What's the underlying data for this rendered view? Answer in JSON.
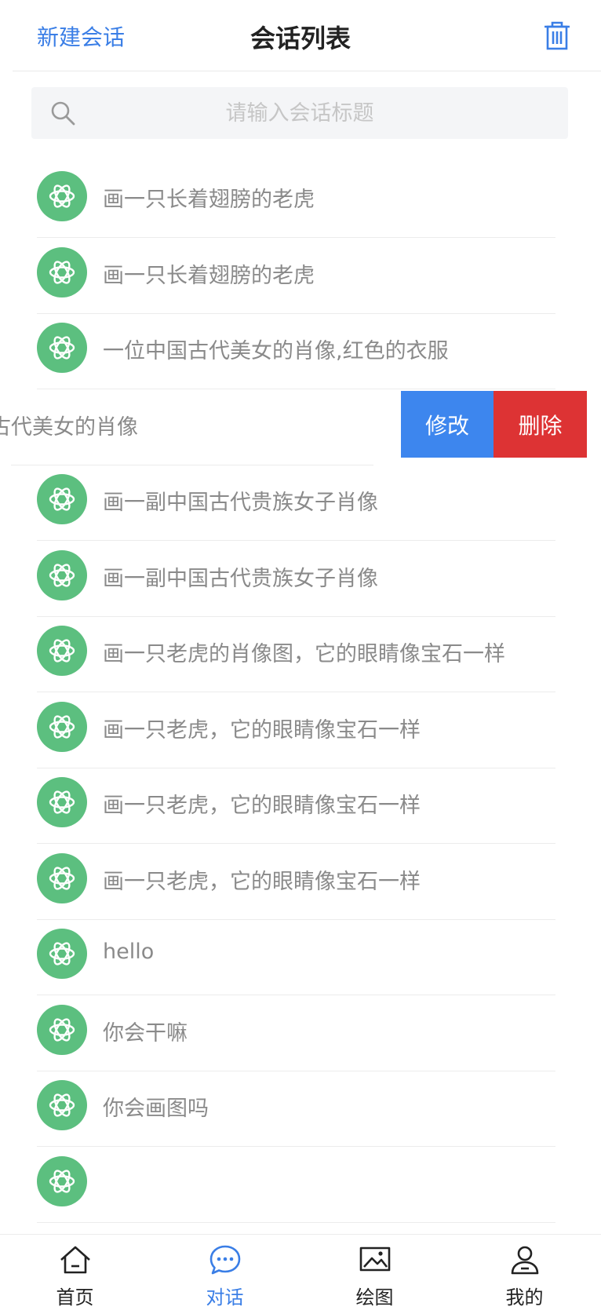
{
  "header": {
    "new_chat_label": "新建会话",
    "title": "会话列表",
    "trash_icon": "trash-icon"
  },
  "search": {
    "placeholder": "请输入会话标题",
    "icon": "search-icon"
  },
  "conversations": [
    {
      "title": "画一只长着翅膀的老虎",
      "icon": "openai-logo-icon"
    },
    {
      "title": "画一只长着翅膀的老虎",
      "icon": "openai-logo-icon"
    },
    {
      "title": "一位中国古代美女的肖像,红色的衣服",
      "icon": "openai-logo-icon"
    },
    {
      "title": "古代美女的肖像",
      "icon": "openai-logo-icon",
      "swiped": true
    },
    {
      "title": "画一副中国古代贵族女子肖像",
      "icon": "openai-logo-icon"
    },
    {
      "title": "画一副中国古代贵族女子肖像",
      "icon": "openai-logo-icon"
    },
    {
      "title": "画一只老虎的肖像图，它的眼睛像宝石一样",
      "icon": "openai-logo-icon"
    },
    {
      "title": "画一只老虎，它的眼睛像宝石一样",
      "icon": "openai-logo-icon"
    },
    {
      "title": "画一只老虎，它的眼睛像宝石一样",
      "icon": "openai-logo-icon"
    },
    {
      "title": "画一只老虎，它的眼睛像宝石一样",
      "icon": "openai-logo-icon"
    },
    {
      "title": "hello",
      "icon": "openai-logo-icon"
    },
    {
      "title": "你会干嘛",
      "icon": "openai-logo-icon"
    },
    {
      "title": "你会画图吗",
      "icon": "openai-logo-icon"
    },
    {
      "title": "",
      "icon": "openai-logo-icon"
    }
  ],
  "swipe_actions": {
    "edit_label": "修改",
    "delete_label": "删除"
  },
  "tabbar": {
    "items": [
      {
        "label": "首页",
        "icon": "home-icon",
        "active": false
      },
      {
        "label": "对话",
        "icon": "chat-bubble-icon",
        "active": true
      },
      {
        "label": "绘图",
        "icon": "image-icon",
        "active": false
      },
      {
        "label": "我的",
        "icon": "user-icon",
        "active": false
      }
    ]
  },
  "colors": {
    "accent": "#3a7ee6",
    "avatar_green": "#5cbf7f",
    "edit_blue": "#3d86ee",
    "delete_red": "#dd3334",
    "text_gray": "#8a8a8a"
  }
}
